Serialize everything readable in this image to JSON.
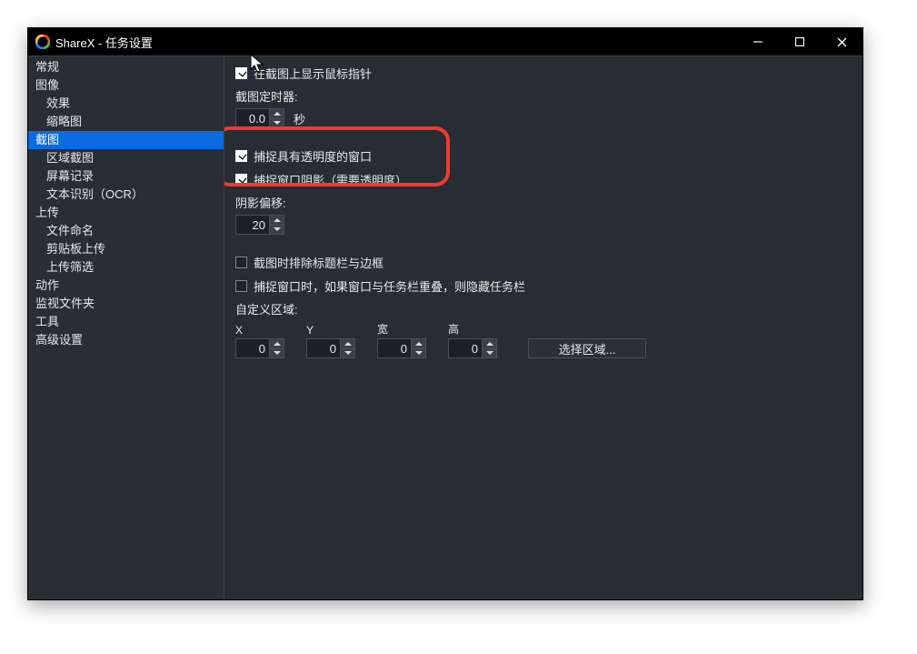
{
  "window": {
    "title": "ShareX - 任务设置"
  },
  "sidebar": {
    "items": [
      {
        "label": "常规",
        "depth": 0
      },
      {
        "label": "图像",
        "depth": 0
      },
      {
        "label": "效果",
        "depth": 1
      },
      {
        "label": "缩略图",
        "depth": 1
      },
      {
        "label": "截图",
        "depth": 0,
        "selected": true
      },
      {
        "label": "区域截图",
        "depth": 1
      },
      {
        "label": "屏幕记录",
        "depth": 1
      },
      {
        "label": "文本识别（OCR）",
        "depth": 1
      },
      {
        "label": "上传",
        "depth": 0
      },
      {
        "label": "文件命名",
        "depth": 1
      },
      {
        "label": "剪贴板上传",
        "depth": 1
      },
      {
        "label": "上传筛选",
        "depth": 1
      },
      {
        "label": "动作",
        "depth": 0
      },
      {
        "label": "监视文件夹",
        "depth": 0
      },
      {
        "label": "工具",
        "depth": 0
      },
      {
        "label": "高级设置",
        "depth": 0
      }
    ]
  },
  "content": {
    "show_cursor_label": "在截图上显示鼠标指针",
    "show_cursor_checked": true,
    "timer_label": "截图定时器:",
    "timer_value": "0.0",
    "timer_unit": "秒",
    "capture_transparent_label": "捕捉具有透明度的窗口",
    "capture_transparent_checked": true,
    "capture_shadow_label": "捕捉窗口阴影（需要透明度）",
    "capture_shadow_checked": true,
    "shadow_offset_label": "阴影偏移:",
    "shadow_offset_value": "20",
    "remove_titlebar_label": "截图时排除标题栏与边框",
    "remove_titlebar_checked": false,
    "hide_taskbar_label": "捕捉窗口时，如果窗口与任务栏重叠，则隐藏任务栏",
    "hide_taskbar_checked": false,
    "custom_region_label": "自定义区域:",
    "region": {
      "x_label": "X",
      "x_value": "0",
      "y_label": "Y",
      "y_value": "0",
      "w_label": "宽",
      "w_value": "0",
      "h_label": "高",
      "h_value": "0"
    },
    "select_region_label": "选择区域..."
  }
}
